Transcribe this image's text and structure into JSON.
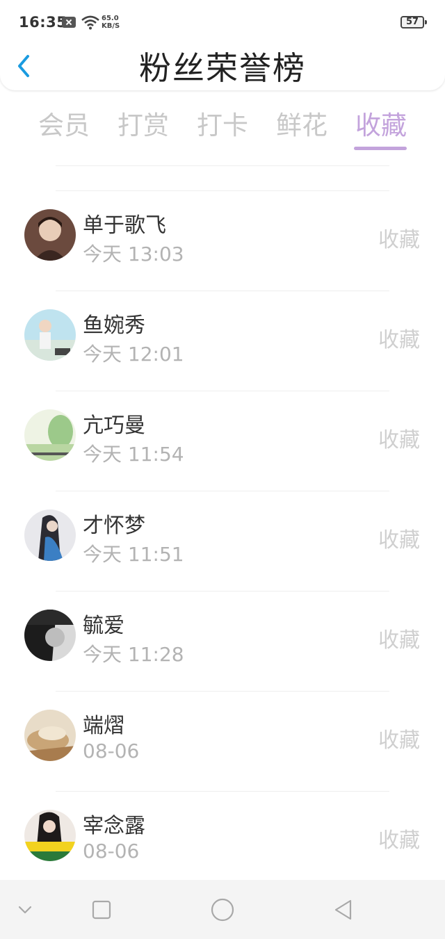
{
  "status_bar": {
    "time": "16:35",
    "network_speed": "65.0",
    "network_unit": "KB/S",
    "battery": "57",
    "icons": [
      "notification-x-icon",
      "wifi-icon",
      "battery-icon"
    ]
  },
  "header": {
    "title": "粉丝荣誉榜",
    "back_icon": "chevron-left-icon",
    "accent_color": "#1a9be0"
  },
  "tabs": [
    {
      "label": "会员",
      "active": false
    },
    {
      "label": "打赏",
      "active": false
    },
    {
      "label": "打卡",
      "active": false
    },
    {
      "label": "鲜花",
      "active": false
    },
    {
      "label": "收藏",
      "active": true
    }
  ],
  "active_tab_color": "#c3a3dc",
  "fans": [
    {
      "name": "单于歌飞",
      "time": "今天 13:03",
      "action": "收藏"
    },
    {
      "name": "鱼婉秀",
      "time": "今天 12:01",
      "action": "收藏"
    },
    {
      "name": "亢巧曼",
      "time": "今天 11:54",
      "action": "收藏"
    },
    {
      "name": "才怀梦",
      "time": "今天 11:51",
      "action": "收藏"
    },
    {
      "name": "毓爱",
      "time": "今天 11:28",
      "action": "收藏"
    },
    {
      "name": "端熠",
      "time": "08-06",
      "action": "收藏"
    },
    {
      "name": "宰念露",
      "time": "08-06",
      "action": "收藏"
    }
  ],
  "nav_bar": {
    "icons": [
      "chevron-down-icon",
      "square-icon",
      "circle-home-icon",
      "triangle-back-icon"
    ]
  }
}
